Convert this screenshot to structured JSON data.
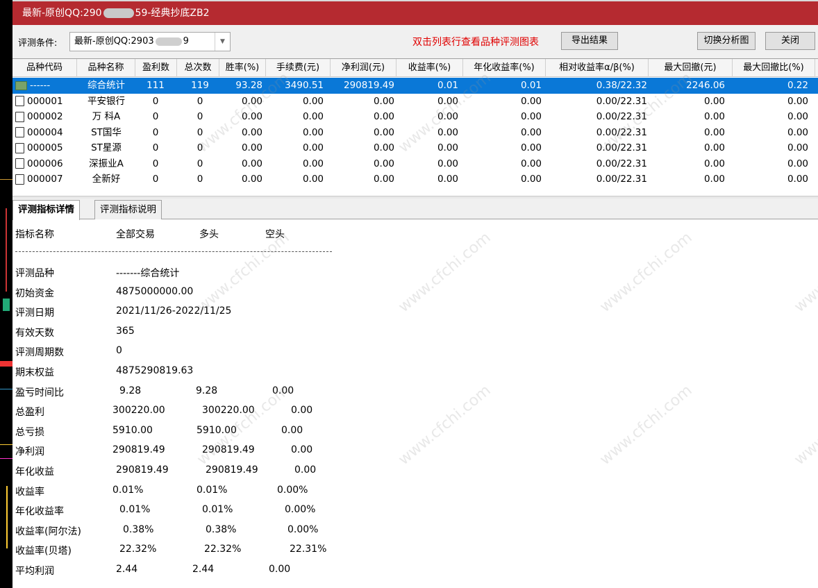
{
  "window": {
    "title_prefix": "最新-原创QQ:290",
    "title_suffix": "59-经典抄底ZB2"
  },
  "condition": {
    "label": "评测条件:",
    "value_prefix": "最新-原创QQ:2903",
    "value_suffix": "9",
    "hint": "双击列表行查看品种评测图表",
    "export_label": "导出结果",
    "switch_label": "切换分析图",
    "close_label": "关闭"
  },
  "table": {
    "columns": [
      "品种代码",
      "品种名称",
      "盈利数",
      "总次数",
      "胜率(%)",
      "手续费(元)",
      "净利润(元)",
      "收益率(%)",
      "年化收益率(%)",
      "相对收益率α/β(%)",
      "最大回撤(元)",
      "最大回撤比(%)"
    ],
    "rows": [
      {
        "code": "------",
        "name": "综合统计",
        "wins": "111",
        "total": "119",
        "win_rate": "93.28",
        "fee": "3490.51",
        "net_profit": "290819.49",
        "return": "0.01",
        "annual_return": "0.01",
        "relative": "0.38/22.32",
        "max_dd": "2246.06",
        "max_dd_ratio": "0.22",
        "selected": true
      },
      {
        "code": "000001",
        "name": "平安银行",
        "wins": "0",
        "total": "0",
        "win_rate": "0.00",
        "fee": "0.00",
        "net_profit": "0.00",
        "return": "0.00",
        "annual_return": "0.00",
        "relative": "0.00/22.31",
        "max_dd": "0.00",
        "max_dd_ratio": "0.00"
      },
      {
        "code": "000002",
        "name": "万 科A",
        "wins": "0",
        "total": "0",
        "win_rate": "0.00",
        "fee": "0.00",
        "net_profit": "0.00",
        "return": "0.00",
        "annual_return": "0.00",
        "relative": "0.00/22.31",
        "max_dd": "0.00",
        "max_dd_ratio": "0.00"
      },
      {
        "code": "000004",
        "name": "ST国华",
        "wins": "0",
        "total": "0",
        "win_rate": "0.00",
        "fee": "0.00",
        "net_profit": "0.00",
        "return": "0.00",
        "annual_return": "0.00",
        "relative": "0.00/22.31",
        "max_dd": "0.00",
        "max_dd_ratio": "0.00"
      },
      {
        "code": "000005",
        "name": "ST星源",
        "wins": "0",
        "total": "0",
        "win_rate": "0.00",
        "fee": "0.00",
        "net_profit": "0.00",
        "return": "0.00",
        "annual_return": "0.00",
        "relative": "0.00/22.31",
        "max_dd": "0.00",
        "max_dd_ratio": "0.00"
      },
      {
        "code": "000006",
        "name": "深振业A",
        "wins": "0",
        "total": "0",
        "win_rate": "0.00",
        "fee": "0.00",
        "net_profit": "0.00",
        "return": "0.00",
        "annual_return": "0.00",
        "relative": "0.00/22.31",
        "max_dd": "0.00",
        "max_dd_ratio": "0.00"
      },
      {
        "code": "000007",
        "name": "全新好",
        "wins": "0",
        "total": "0",
        "win_rate": "0.00",
        "fee": "0.00",
        "net_profit": "0.00",
        "return": "0.00",
        "annual_return": "0.00",
        "relative": "0.00/22.31",
        "max_dd": "0.00",
        "max_dd_ratio": "0.00"
      }
    ]
  },
  "tabs": [
    "评测指标详情",
    "评测指标说明"
  ],
  "detail": {
    "headers": [
      "指标名称",
      "全部交易",
      "多头",
      "空头"
    ],
    "separator": "------------------------------------------------------------------------",
    "info": [
      {
        "label": "评测品种",
        "value": "-------综合统计"
      },
      {
        "label": "初始资金",
        "value": "4875000000.00"
      },
      {
        "label": "评测日期",
        "value": "2021/11/26-2022/11/25"
      },
      {
        "label": "有效天数",
        "value": "365"
      },
      {
        "label": "评测周期数",
        "value": "0"
      },
      {
        "label": "期末权益",
        "value": "4875290819.63"
      }
    ],
    "metrics": [
      {
        "label": "盈亏时间比",
        "all": "9.28",
        "long": "9.28",
        "short": "0.00"
      },
      {
        "label": "总盈利",
        "all": "300220.00",
        "long": "300220.00",
        "short": "0.00"
      },
      {
        "label": "总亏损",
        "all": "5910.00",
        "long": "5910.00",
        "short": "0.00"
      },
      {
        "label": "净利润",
        "all": "290819.49",
        "long": "290819.49",
        "short": "0.00"
      },
      {
        "label": "年化收益",
        "all": "290819.49",
        "long": "290819.49",
        "short": "0.00"
      },
      {
        "label": "收益率",
        "all": "0.01%",
        "long": "0.01%",
        "short": "0.00%"
      },
      {
        "label": "年化收益率",
        "all": "0.01%",
        "long": "0.01%",
        "short": "0.00%"
      },
      {
        "label": "收益率(阿尔法)",
        "all": "0.38%",
        "long": "0.38%",
        "short": "0.00%"
      },
      {
        "label": "收益率(贝塔)",
        "all": "22.32%",
        "long": "22.32%",
        "short": "22.31%"
      },
      {
        "label": "平均利润",
        "all": "2.44",
        "long": "2.44",
        "short": "0.00"
      }
    ]
  },
  "watermark": "www.cfchi.com",
  "colors": {
    "title_bar": "#b52a30",
    "selection": "#0a78d7",
    "hint": "#e00000"
  }
}
